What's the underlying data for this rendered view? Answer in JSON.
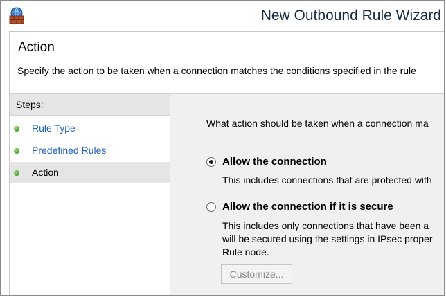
{
  "window": {
    "title": "New Outbound Rule Wizard",
    "icon": "firewall-wizard-icon"
  },
  "page": {
    "heading": "Action",
    "subtitle": "Specify the action to be taken when a connection matches the conditions specified in the rule"
  },
  "steps": {
    "header": "Steps:",
    "items": [
      {
        "label": "Rule Type",
        "state": "completed"
      },
      {
        "label": "Predefined Rules",
        "state": "completed"
      },
      {
        "label": "Action",
        "state": "current"
      }
    ],
    "dot_color": "#3f9e2b"
  },
  "main": {
    "question": "What action should be taken when a connection ma",
    "options": [
      {
        "label": "Allow the connection",
        "selected": true,
        "description": [
          "This includes connections that are protected with"
        ]
      },
      {
        "label": "Allow the connection if it is secure",
        "selected": false,
        "description": [
          "This includes only connections that have been a",
          "will be secured using the settings in IPsec proper",
          "Rule node."
        ]
      }
    ],
    "customize_label": "Customize..."
  },
  "colors": {
    "link": "#1f5fb7",
    "title_text": "#1a2b44",
    "panel_bg": "#f0f0f0",
    "steps_header_bg": "#e6e6e6"
  }
}
